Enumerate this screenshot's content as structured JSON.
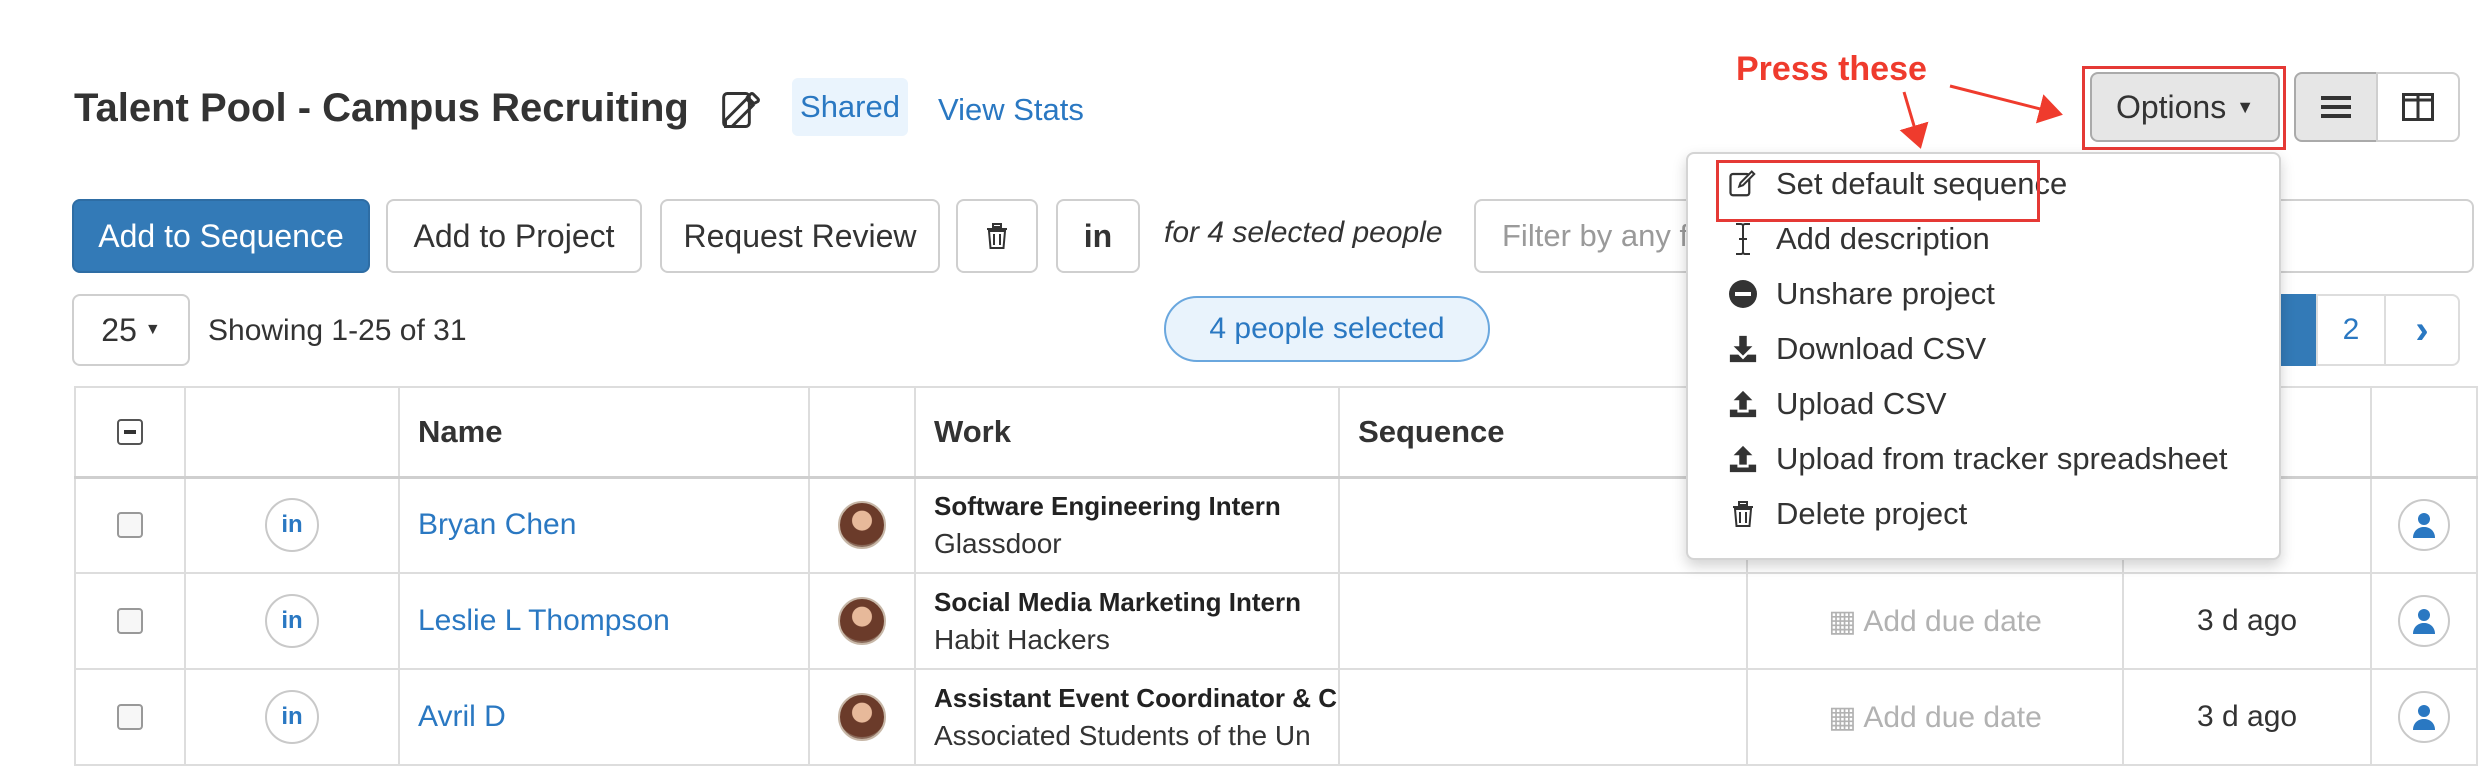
{
  "header": {
    "title": "Talent Pool - Campus Recruiting",
    "shared_label": "Shared",
    "view_stats_label": "View Stats",
    "options_label": "Options"
  },
  "toolbar": {
    "add_to_sequence": "Add to Sequence",
    "add_to_project": "Add to Project",
    "request_review": "Request Review",
    "selected_text": "for 4 selected people",
    "filter_placeholder": "Filter by any f"
  },
  "pagination": {
    "page_size": "25",
    "showing": "Showing 1-25 of 31",
    "selected_pill": "4 people selected",
    "page_2": "2",
    "next": "›"
  },
  "table": {
    "columns": [
      "Name",
      "Work",
      "Sequence"
    ],
    "rows": [
      {
        "name": "Bryan Chen",
        "title": "Software Engineering Intern",
        "company": "Glassdoor",
        "due": "",
        "ago": ""
      },
      {
        "name": "Leslie L Thompson",
        "title": "Social Media Marketing Intern",
        "company": "Habit Hackers",
        "due": "Add due date",
        "ago": "3 d ago"
      },
      {
        "name": "Avril D",
        "title": "Assistant Event Coordinator & C",
        "company": "Associated Students of the Un",
        "due": "Add due date",
        "ago": "3 d ago"
      }
    ]
  },
  "dropdown": {
    "items": [
      {
        "label": "Set default sequence",
        "icon": "edit-icon"
      },
      {
        "label": "Add description",
        "icon": "text-cursor-icon"
      },
      {
        "label": "Unshare project",
        "icon": "minus-circle-icon"
      },
      {
        "label": "Download CSV",
        "icon": "download-icon"
      },
      {
        "label": "Upload CSV",
        "icon": "upload-icon"
      },
      {
        "label": "Upload from tracker spreadsheet",
        "icon": "upload-icon"
      },
      {
        "label": "Delete project",
        "icon": "trash-icon"
      }
    ]
  },
  "annotation": {
    "text": "Press these",
    "color": "#ef3b2d"
  },
  "colors": {
    "primary": "#337ab7",
    "link": "#2a78c2"
  }
}
